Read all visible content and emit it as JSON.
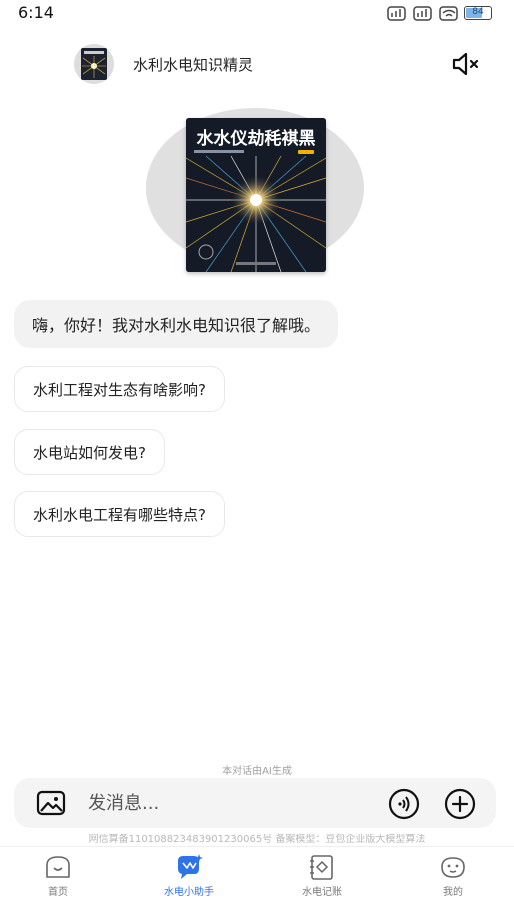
{
  "status_bar": {
    "time": "6:14",
    "battery": "84"
  },
  "header": {
    "title": "水利水电知识精灵"
  },
  "hero": {
    "book_title": "水水仪劫秏褀黑"
  },
  "chat": {
    "greeting": "嗨，你好！我对水利水电知识很了解哦。",
    "suggestions": [
      "水利工程对生态有啥影响?",
      "水电站如何发电?",
      "水利水电工程有哪些特点?"
    ]
  },
  "ai_note": "本对话由AI生成",
  "input": {
    "placeholder": "发消息..."
  },
  "icp": "网信算备110108823483901230065号 备案模型：豆包企业版大模型算法",
  "tabs": [
    {
      "label": "首页",
      "icon": "home-icon"
    },
    {
      "label": "水电小助手",
      "icon": "assistant-icon"
    },
    {
      "label": "水电记账",
      "icon": "ledger-icon"
    },
    {
      "label": "我的",
      "icon": "profile-icon"
    }
  ],
  "colors": {
    "accent": "#2e74e8",
    "bubble": "#f2f2f2"
  }
}
